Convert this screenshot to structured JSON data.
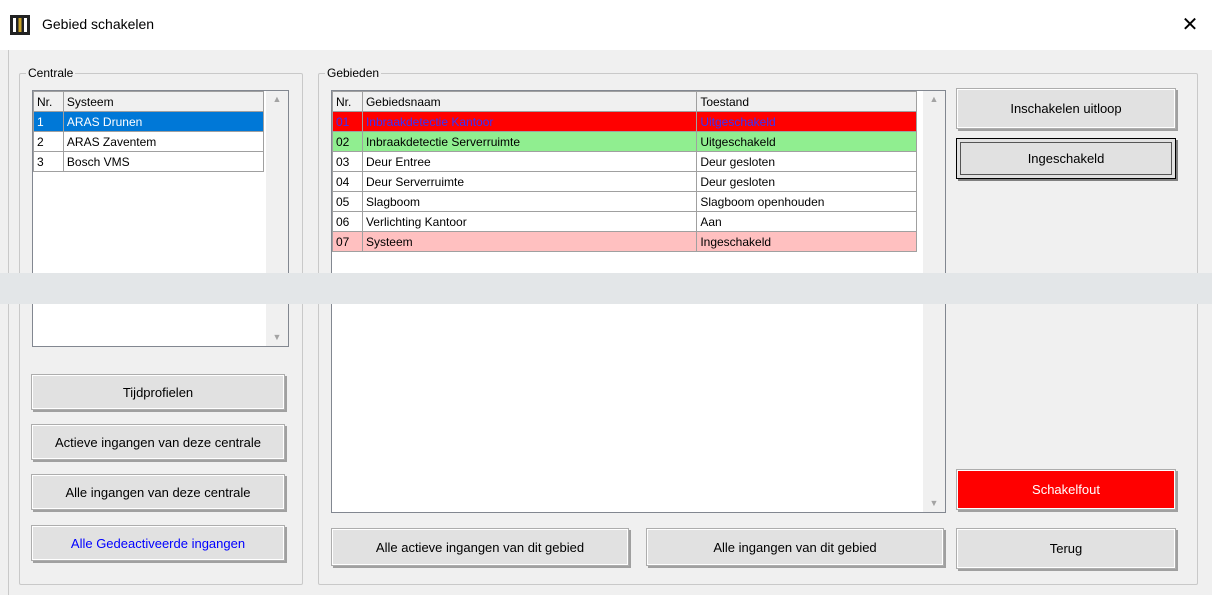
{
  "window": {
    "title": "Gebied schakelen",
    "close_glyph": "✕"
  },
  "centrale": {
    "legend": "Centrale",
    "columns": [
      "Nr.",
      "Systeem"
    ],
    "rows": [
      {
        "nr": "1",
        "systeem": "ARAS Drunen",
        "selected": true
      },
      {
        "nr": "2",
        "systeem": "ARAS Zaventem"
      },
      {
        "nr": "3",
        "systeem": "Bosch VMS"
      }
    ],
    "buttons": {
      "tijdprofielen": "Tijdprofielen",
      "actieve_ingangen": "Actieve ingangen van deze centrale",
      "alle_ingangen": "Alle ingangen van deze centrale",
      "gedeactiveerde": "Alle Gedeactiveerde ingangen"
    }
  },
  "gebieden": {
    "legend": "Gebieden",
    "columns": [
      "Nr.",
      "Gebiedsnaam",
      "Toestand"
    ],
    "rows": [
      {
        "nr": "01",
        "naam": "Inbraakdetectie Kantoor",
        "toestand": "Uitgeschakeld",
        "color": "#ff0000"
      },
      {
        "nr": "02",
        "naam": "Inbraakdetectie Serverruimte",
        "toestand": "Uitgeschakeld",
        "color": "#90ee90"
      },
      {
        "nr": "03",
        "naam": "Deur Entree",
        "toestand": "Deur gesloten",
        "color": "#ffffff"
      },
      {
        "nr": "04",
        "naam": "Deur Serverruimte",
        "toestand": "Deur gesloten",
        "color": "#ffffff"
      },
      {
        "nr": "05",
        "naam": "Slagboom",
        "toestand": "Slagboom openhouden",
        "color": "#ffffff"
      },
      {
        "nr": "06",
        "naam": "Verlichting Kantoor",
        "toestand": "Aan",
        "color": "#ffffff"
      },
      {
        "nr": "07",
        "naam": "Systeem",
        "toestand": "Ingeschakeld",
        "color": "#ffc0c0"
      }
    ],
    "buttons": {
      "alle_actieve": "Alle actieve ingangen van dit gebied",
      "alle_ingangen": "Alle ingangen van dit gebied"
    }
  },
  "actions": {
    "inschakelen_uitloop": "Inschakelen uitloop",
    "ingeschakeld": "Ingeschakeld",
    "schakelfout": "Schakelfout",
    "terug": "Terug"
  },
  "colors": {
    "selection": "#0078d7",
    "error": "#ff0000",
    "ok": "#90ee90",
    "warn": "#ffc0c0",
    "link": "#0000ff"
  }
}
